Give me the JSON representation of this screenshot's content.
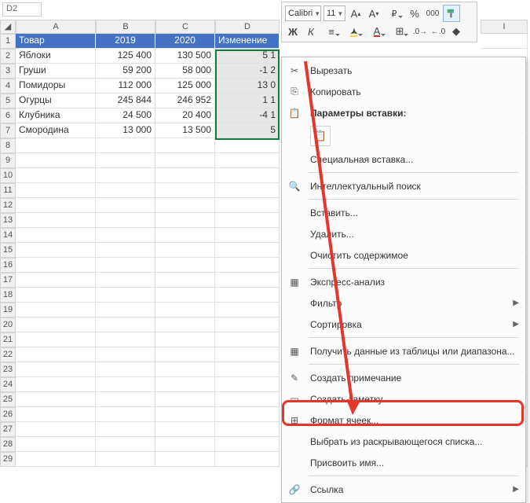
{
  "namebox": "D2",
  "toolbar": {
    "font_name": "Calibri",
    "font_size": "11",
    "bold": "Ж",
    "italic": "К"
  },
  "columns": [
    "",
    "A",
    "B",
    "C",
    "D"
  ],
  "right_col": "I",
  "header_row": {
    "a": "Товар",
    "b": "2019",
    "c": "2020",
    "d": "Изменение"
  },
  "rows": [
    {
      "a": "Яблоки",
      "b": "125 400",
      "c": "130 500",
      "d": "5 1"
    },
    {
      "a": "Груши",
      "b": "59 200",
      "c": "58 000",
      "d": "-1 2"
    },
    {
      "a": "Помидоры",
      "b": "112 000",
      "c": "125 000",
      "d": "13 0"
    },
    {
      "a": "Огурцы",
      "b": "245 844",
      "c": "246 952",
      "d": "1 1"
    },
    {
      "a": "Клубника",
      "b": "24 500",
      "c": "20 400",
      "d": "-4 1"
    },
    {
      "a": "Смородина",
      "b": "13 000",
      "c": "13 500",
      "d": "5"
    }
  ],
  "row_count": 29,
  "ctx": {
    "cut": "Вырезать",
    "copy": "Копировать",
    "paste_opts": "Параметры вставки:",
    "paste_special": "Специальная вставка...",
    "smart_lookup": "Интеллектуальный поиск",
    "insert": "Вставить...",
    "delete": "Удалить...",
    "clear": "Очистить содержимое",
    "quick_analysis": "Экспресс-анализ",
    "filter": "Фильтр",
    "sort": "Сортировка",
    "get_data": "Получить данные из таблицы или диапазона...",
    "new_comment": "Создать примечание",
    "new_note": "Создать заметку",
    "format_cells": "Формат ячеек...",
    "dropdown_pick": "Выбрать из раскрывающегося списка...",
    "define_name": "Присвоить имя...",
    "link": "Ссылка"
  }
}
